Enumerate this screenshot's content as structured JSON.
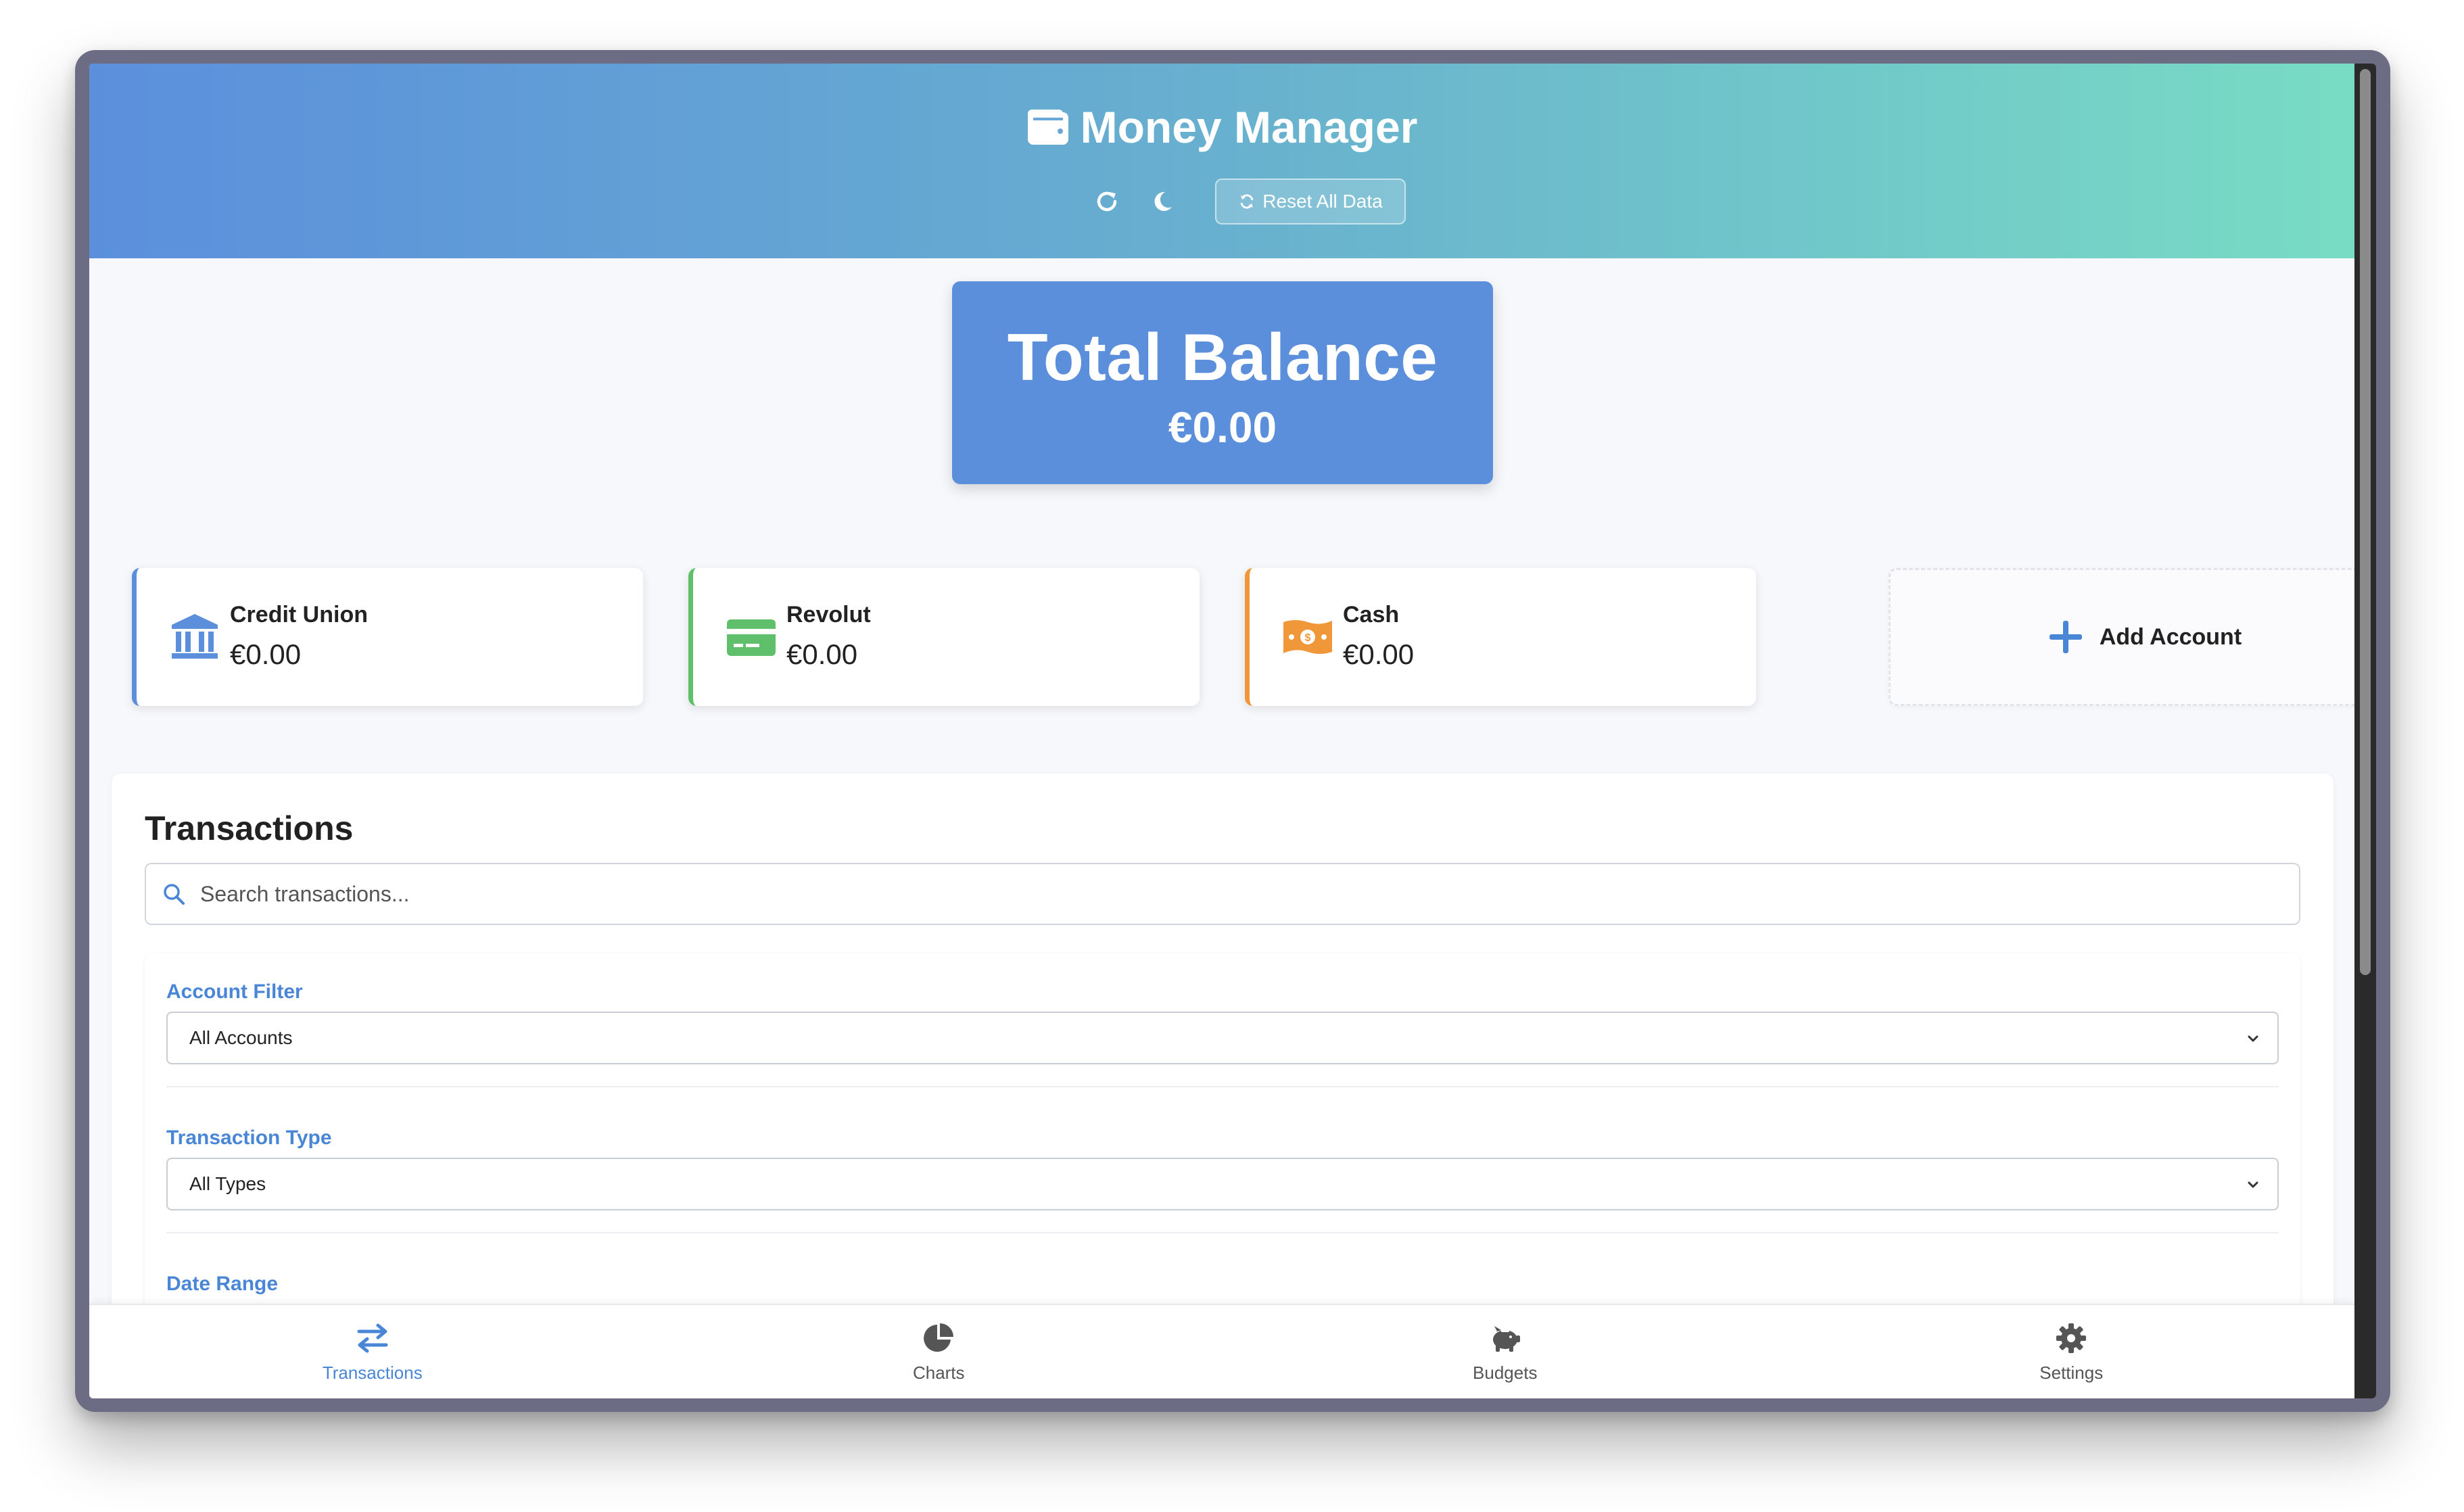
{
  "header": {
    "title": "Money Manager",
    "reset_label": "Reset All Data",
    "icons": [
      "wallet-icon",
      "refresh-icon",
      "moon-icon",
      "sync-icon"
    ]
  },
  "balance": {
    "title": "Total Balance",
    "amount": "€0.00"
  },
  "accounts": [
    {
      "name": "Credit Union",
      "balance": "€0.00",
      "icon": "bank-icon",
      "color": "#5b8fdc"
    },
    {
      "name": "Revolut",
      "balance": "€0.00",
      "icon": "credit-card-icon",
      "color": "#5fbf6a"
    },
    {
      "name": "Cash",
      "balance": "€0.00",
      "icon": "money-bill-icon",
      "color": "#f0973a"
    }
  ],
  "add_account": {
    "label": "Add Account",
    "icon": "plus-icon"
  },
  "transactions": {
    "title": "Transactions",
    "search_placeholder": "Search transactions...",
    "filters": {
      "account_label": "Account Filter",
      "account_value": "All Accounts",
      "type_label": "Transaction Type",
      "type_value": "All Types",
      "date_label": "Date Range"
    }
  },
  "nav": [
    {
      "label": "Transactions",
      "icon": "exchange-icon",
      "active": true
    },
    {
      "label": "Charts",
      "icon": "pie-chart-icon",
      "active": false
    },
    {
      "label": "Budgets",
      "icon": "piggy-bank-icon",
      "active": false
    },
    {
      "label": "Settings",
      "icon": "gear-icon",
      "active": false
    }
  ],
  "colors": {
    "accent": "#5b8fdc",
    "gradient_start": "#5b8fdc",
    "gradient_end": "#78dcc4"
  }
}
